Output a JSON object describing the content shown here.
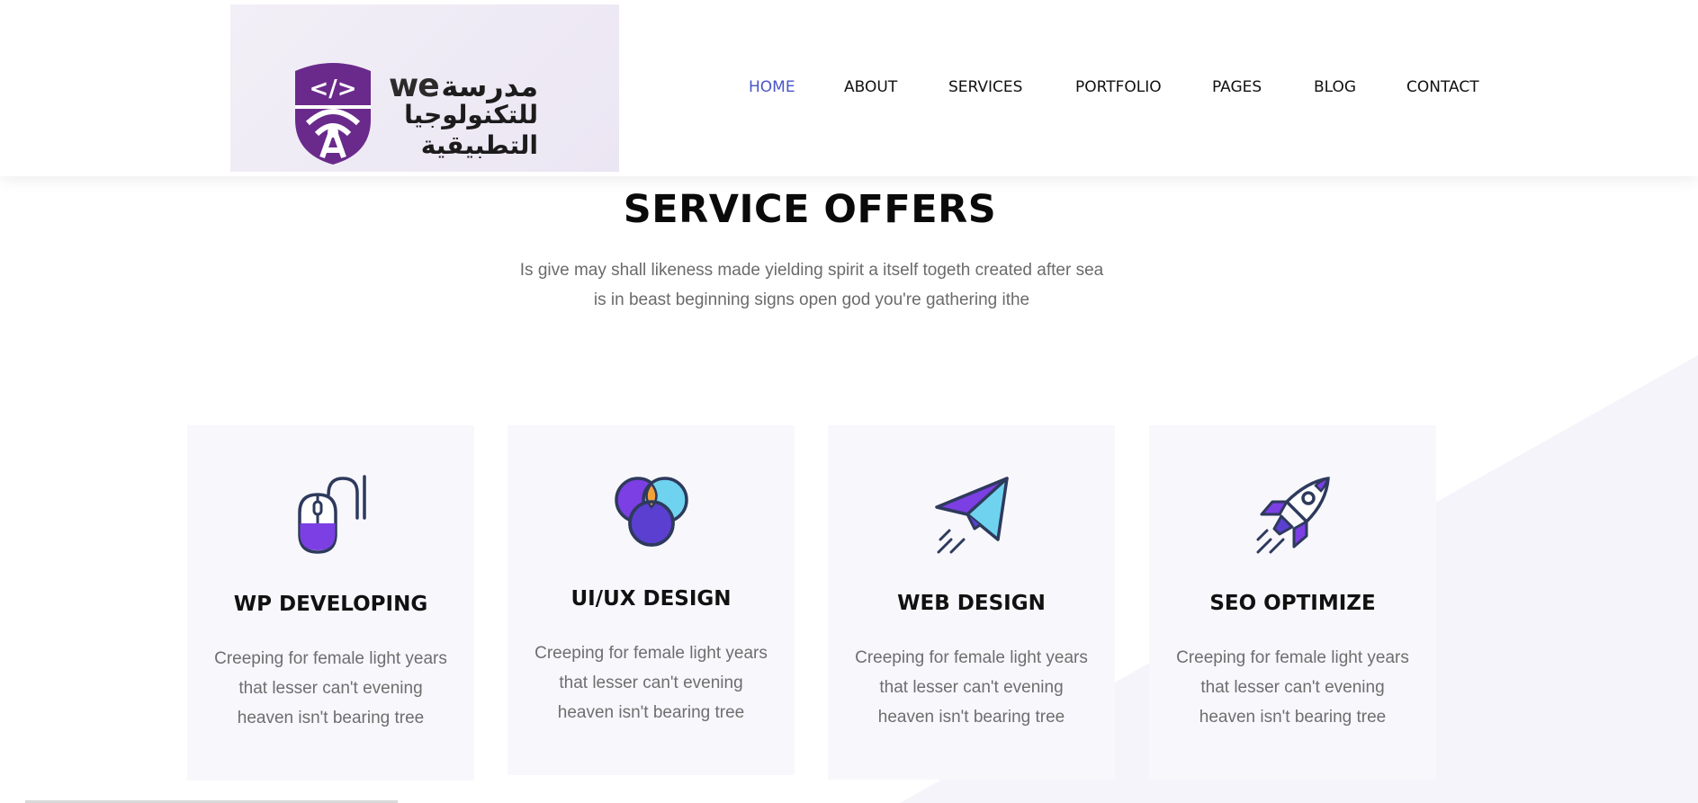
{
  "brand": {
    "logo_latin": "we",
    "logo_arabic_line1": "مدرسة",
    "logo_arabic_line2": "للتكنولوجيا",
    "logo_arabic_line3": "التطبيقية",
    "logo_symbol": "</>"
  },
  "nav": {
    "items": [
      {
        "label": "HOME",
        "active": true
      },
      {
        "label": "ABOUT",
        "active": false
      },
      {
        "label": "SERVICES",
        "active": false
      },
      {
        "label": "PORTFOLIO",
        "active": false
      },
      {
        "label": "PAGES",
        "active": false
      },
      {
        "label": "BLOG",
        "active": false
      },
      {
        "label": "CONTACT",
        "active": false
      }
    ]
  },
  "section": {
    "title": "SERVICE OFFERS",
    "subtitle_line1": "Is give may shall likeness made yielding spirit a itself togeth created after sea",
    "subtitle_line2": "is in beast beginning signs open god you're gathering ithe"
  },
  "cards": [
    {
      "icon": "mouse-icon",
      "title": "WP DEVELOPING",
      "desc_line1": "Creeping for female light years",
      "desc_line2": "that lesser can't evening",
      "desc_line3": "heaven isn't bearing tree"
    },
    {
      "icon": "venn-circles-icon",
      "title": "UI/UX DESIGN",
      "desc_line1": "Creeping for female light years",
      "desc_line2": "that lesser can't evening",
      "desc_line3": "heaven isn't bearing tree"
    },
    {
      "icon": "paper-plane-icon",
      "title": "WEB DESIGN",
      "desc_line1": "Creeping for female light years",
      "desc_line2": "that lesser can't evening",
      "desc_line3": "heaven isn't bearing tree"
    },
    {
      "icon": "rocket-icon",
      "title": "SEO OPTIMIZE",
      "desc_line1": "Creeping for female light years",
      "desc_line2": "that lesser can't evening",
      "desc_line3": "heaven isn't bearing tree"
    }
  ],
  "colors": {
    "accent": "#4a55c8",
    "brand_purple": "#6a2a8c",
    "card_bg": "#f8f7fc",
    "icon_purple": "#7b3fe4",
    "icon_dark": "#2e3a5c",
    "icon_cyan": "#6fd3f0",
    "icon_orange": "#f4a13a"
  }
}
